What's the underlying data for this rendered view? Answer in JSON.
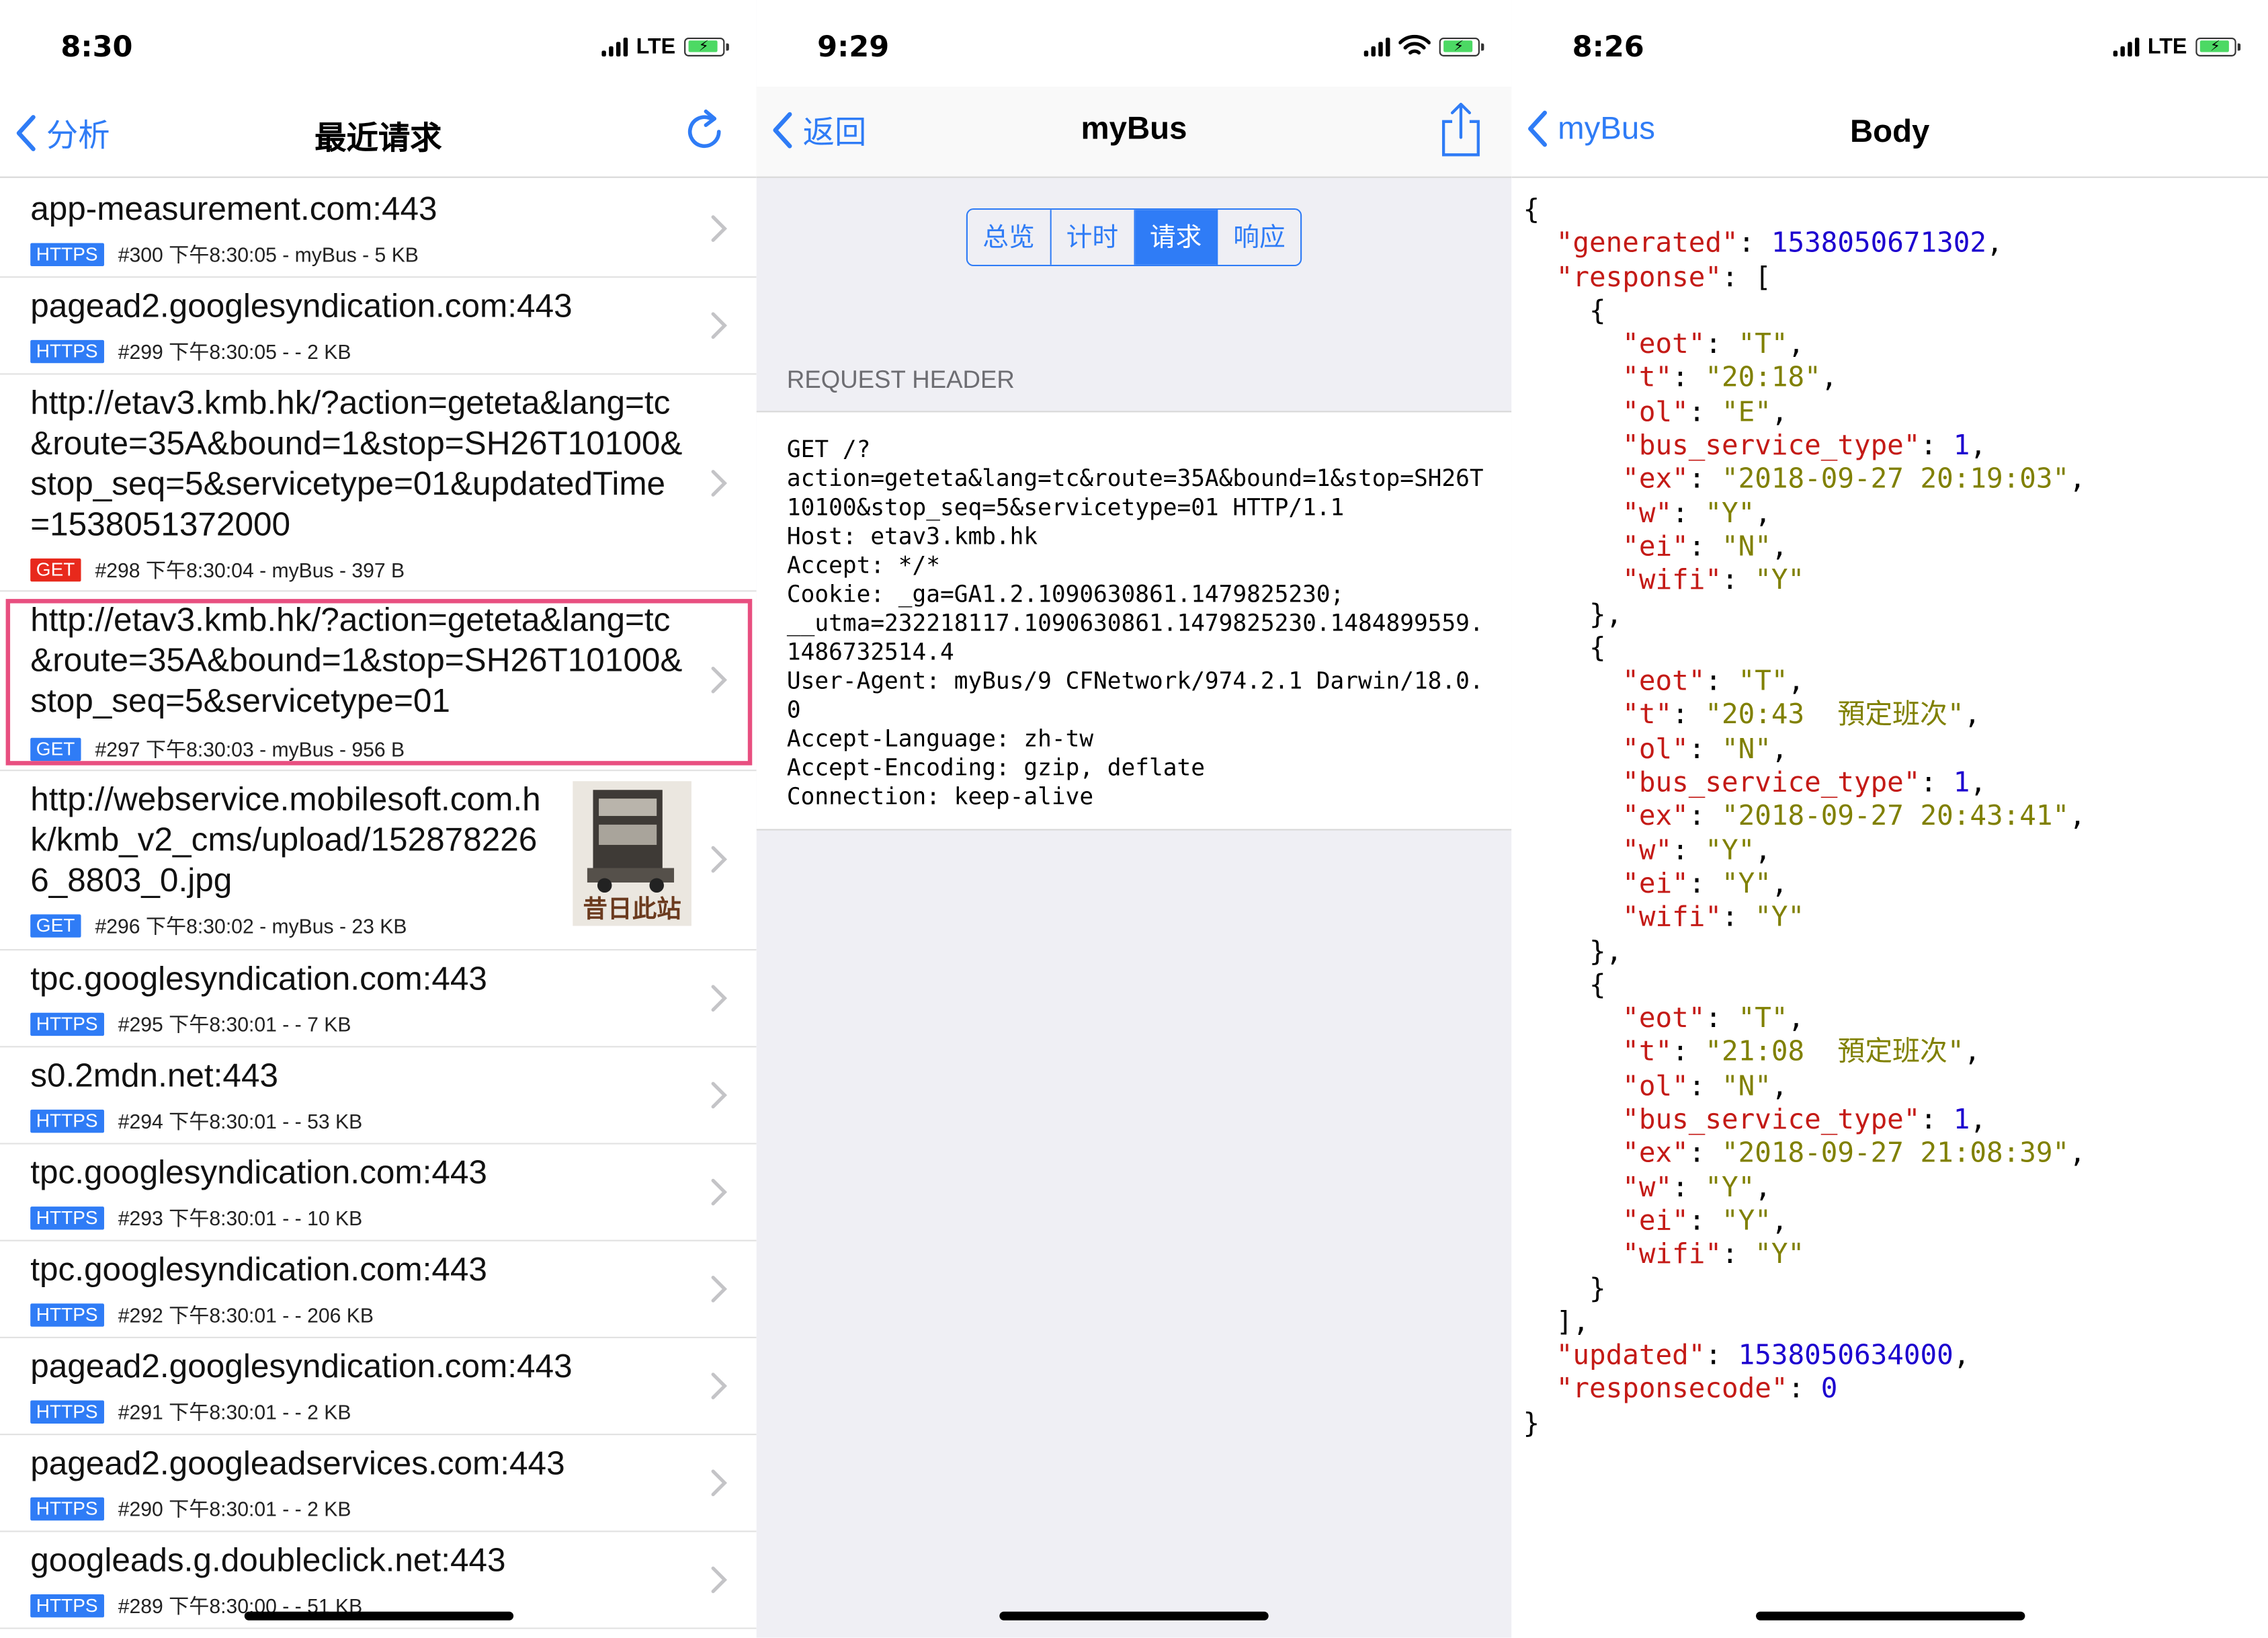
{
  "panel_list": {
    "status": {
      "time": "8:30",
      "network": "LTE"
    },
    "nav": {
      "back_label": "分析",
      "title": "最近请求",
      "refresh_icon": "refresh-icon"
    },
    "rows": [
      {
        "url": "app-measurement.com:443",
        "method": "HTTPS",
        "meta": "#300 下午8:30:05 - myBus - 5 KB"
      },
      {
        "url": "pagead2.googlesyndication.com:443",
        "method": "HTTPS",
        "meta": "#299 下午8:30:05 - - 2 KB"
      },
      {
        "url": "http://etav3.kmb.hk/?action=geteta&lang=tc&route=35A&bound=1&stop=SH26T10100&stop_seq=5&servicetype=01&updatedTime=1538051372000",
        "method": "GET",
        "meta": "#298 下午8:30:04 - myBus - 397 B"
      },
      {
        "url": "http://etav3.kmb.hk/?action=geteta&lang=tc&route=35A&bound=1&stop=SH26T10100&stop_seq=5&servicetype=01",
        "method": "GET",
        "meta": "#297 下午8:30:03 - myBus - 956 B"
      },
      {
        "url": "http://webservice.mobilesoft.com.hk/kmb_v2_cms/upload/1528782266_8803_0.jpg",
        "method": "GET",
        "meta": "#296 下午8:30:02 - myBus - 23 KB",
        "thumb_caption": "昔日此站"
      },
      {
        "url": "tpc.googlesyndication.com:443",
        "method": "HTTPS",
        "meta": "#295 下午8:30:01 - - 7 KB"
      },
      {
        "url": "s0.2mdn.net:443",
        "method": "HTTPS",
        "meta": "#294 下午8:30:01 - - 53 KB"
      },
      {
        "url": "tpc.googlesyndication.com:443",
        "method": "HTTPS",
        "meta": "#293 下午8:30:01 - - 10 KB"
      },
      {
        "url": "tpc.googlesyndication.com:443",
        "method": "HTTPS",
        "meta": "#292 下午8:30:01 - - 206 KB"
      },
      {
        "url": "pagead2.googlesyndication.com:443",
        "method": "HTTPS",
        "meta": "#291 下午8:30:01 - - 2 KB"
      },
      {
        "url": "pagead2.googleadservices.com:443",
        "method": "HTTPS",
        "meta": "#290 下午8:30:01 - - 2 KB"
      },
      {
        "url": "googleads.g.doubleclick.net:443",
        "method": "HTTPS",
        "meta": "#289 下午8:30:00 - - 51 KB"
      }
    ]
  },
  "panel_request": {
    "status": {
      "time": "9:29"
    },
    "nav": {
      "back_label": "返回",
      "title": "myBus",
      "share_icon": "share-icon"
    },
    "tabs": [
      "总览",
      "计时",
      "请求",
      "响应"
    ],
    "selected_tab": "请求",
    "section_title": "REQUEST HEADER",
    "header_text": "GET /?\naction=geteta&lang=tc&route=35A&bound=1&stop=SH26T10100&stop_seq=5&servicetype=01 HTTP/1.1\nHost: etav3.kmb.hk\nAccept: */*\nCookie: _ga=GA1.2.1090630861.1479825230;\n__utma=232218117.1090630861.1479825230.1484899559.1486732514.4\nUser-Agent: myBus/9 CFNetwork/974.2.1 Darwin/18.0.0\nAccept-Language: zh-tw\nAccept-Encoding: gzip, deflate\nConnection: keep-alive"
  },
  "panel_body": {
    "status": {
      "time": "8:26",
      "network": "LTE"
    },
    "nav": {
      "back_label": "myBus",
      "title": "Body"
    },
    "json": {
      "generated": 1538050671302,
      "response": [
        {
          "eot": "T",
          "t": "20:18",
          "ol": "E",
          "bus_service_type": 1,
          "ex": "2018-09-27 20:19:03",
          "w": "Y",
          "ei": "N",
          "wifi": "Y"
        },
        {
          "eot": "T",
          "t": "20:43  預定班次",
          "ol": "N",
          "bus_service_type": 1,
          "ex": "2018-09-27 20:43:41",
          "w": "Y",
          "ei": "Y",
          "wifi": "Y"
        },
        {
          "eot": "T",
          "t": "21:08  預定班次",
          "ol": "N",
          "bus_service_type": 1,
          "ex": "2018-09-27 21:08:39",
          "w": "Y",
          "ei": "Y",
          "wifi": "Y"
        }
      ],
      "updated": 1538050634000,
      "responsecode": 0
    }
  },
  "colors": {
    "accent": "#2f7cf6",
    "get_red": "#e8291c",
    "highlight": "#e84f80",
    "json_key": "#c41a16",
    "json_string": "#808000",
    "json_number": "#1c00cf"
  }
}
